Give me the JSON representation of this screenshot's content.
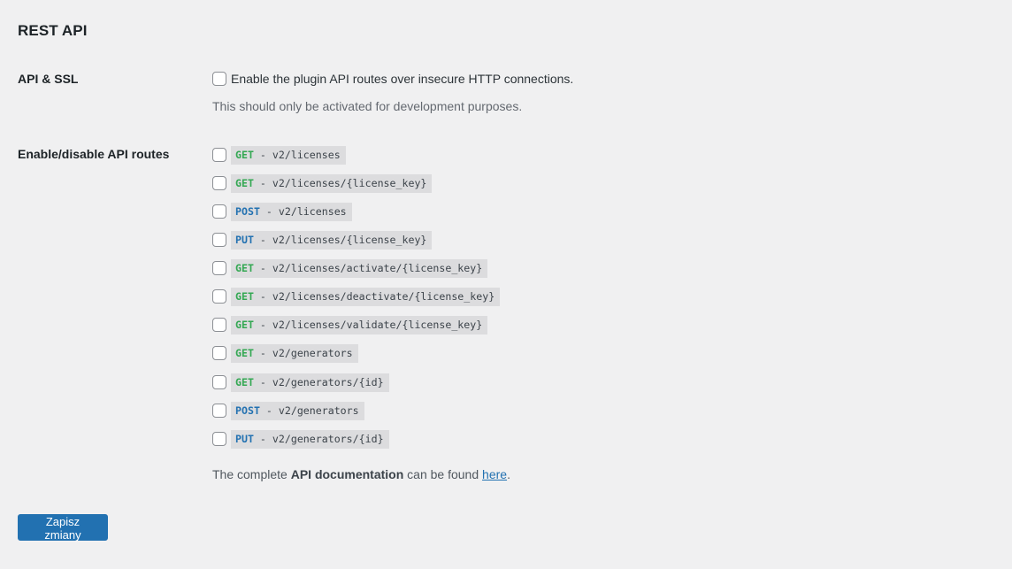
{
  "section": {
    "title": "REST API"
  },
  "ssl": {
    "label": "API & SSL",
    "checkbox_label": "Enable the plugin API routes over insecure HTTP connections.",
    "checked": false,
    "description": "This should only be activated for development purposes."
  },
  "routes_section": {
    "label": "Enable/disable API routes",
    "routes": [
      {
        "method": "GET",
        "path": "v2/licenses",
        "checked": false
      },
      {
        "method": "GET",
        "path": "v2/licenses/{license_key}",
        "checked": false
      },
      {
        "method": "POST",
        "path": "v2/licenses",
        "checked": false
      },
      {
        "method": "PUT",
        "path": "v2/licenses/{license_key}",
        "checked": false
      },
      {
        "method": "GET",
        "path": "v2/licenses/activate/{license_key}",
        "checked": false
      },
      {
        "method": "GET",
        "path": "v2/licenses/deactivate/{license_key}",
        "checked": false
      },
      {
        "method": "GET",
        "path": "v2/licenses/validate/{license_key}",
        "checked": false
      },
      {
        "method": "GET",
        "path": "v2/generators",
        "checked": false
      },
      {
        "method": "GET",
        "path": "v2/generators/{id}",
        "checked": false
      },
      {
        "method": "POST",
        "path": "v2/generators",
        "checked": false
      },
      {
        "method": "PUT",
        "path": "v2/generators/{id}",
        "checked": false
      }
    ],
    "separator": " - "
  },
  "docs": {
    "prefix": "The complete ",
    "bold": "API documentation",
    "middle": " can be found ",
    "link_text": "here",
    "suffix": "."
  },
  "save_button": {
    "label": "Zapisz zmiany"
  },
  "colors": {
    "background": "#f0f0f1",
    "get": "#34a853",
    "post_put": "#2271b1",
    "code_bg": "#dcdcde",
    "button": "#2271b1"
  }
}
